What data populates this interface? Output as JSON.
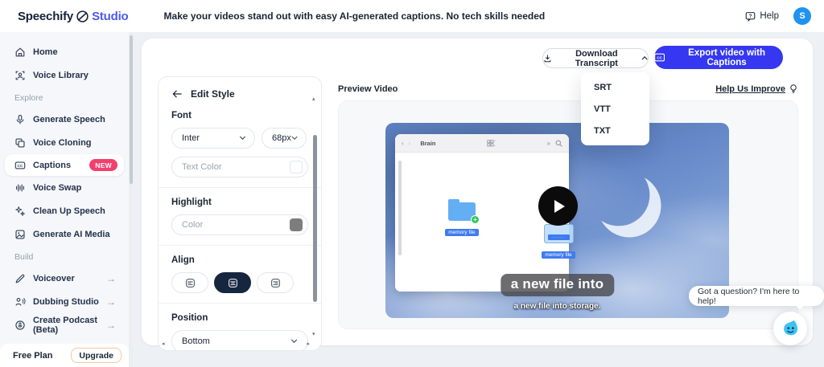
{
  "header": {
    "logo_primary": "Speechify",
    "logo_secondary": "Studio",
    "tagline": "Make your videos stand out with easy AI-generated captions. No tech skills needed",
    "help_label": "Help",
    "avatar_initial": "S"
  },
  "sidebar": {
    "items": [
      {
        "label": "Home"
      },
      {
        "label": "Voice Library"
      }
    ],
    "explore_label": "Explore",
    "explore_items": [
      {
        "label": "Generate Speech"
      },
      {
        "label": "Voice Cloning"
      },
      {
        "label": "Captions",
        "badge": "NEW"
      },
      {
        "label": "Voice Swap"
      },
      {
        "label": "Clean Up Speech"
      },
      {
        "label": "Generate AI Media"
      }
    ],
    "build_label": "Build",
    "build_items": [
      {
        "label": "Voiceover",
        "arrow": "→"
      },
      {
        "label": "Dubbing Studio",
        "arrow": "→"
      },
      {
        "label": "Create Podcast (Beta)",
        "arrow": "→"
      }
    ],
    "plan_label": "Free Plan",
    "upgrade_label": "Upgrade"
  },
  "toolbar": {
    "download_label": "Download Transcript",
    "export_label": "Export video with Captions",
    "dropdown_items": [
      "SRT",
      "VTT",
      "TXT"
    ]
  },
  "edit_style": {
    "title": "Edit Style",
    "font_label": "Font",
    "font_family_value": "Inter",
    "font_size_value": "68px",
    "text_color_placeholder": "Text Color",
    "highlight_label": "Highlight",
    "highlight_color_placeholder": "Color",
    "align_label": "Align",
    "position_label": "Position",
    "position_value": "Bottom"
  },
  "preview": {
    "title": "Preview Video",
    "improve_label": "Help Us Improve",
    "video": {
      "window_title": "Brain",
      "folder_label": "memory file",
      "file_label": "memory file",
      "caption_main": "a new file into",
      "caption_sub": "a new file into storage."
    }
  },
  "chat": {
    "message": "Got a question? I'm here to help!"
  },
  "colors": {
    "accent_blue": "#3538f0",
    "studio_blue": "#4a5af0",
    "badge_pink": "#f43f6e",
    "avatar_blue": "#1f93ef",
    "mascot_blue": "#3ec3f5",
    "align_selected_navy": "#17263f"
  }
}
